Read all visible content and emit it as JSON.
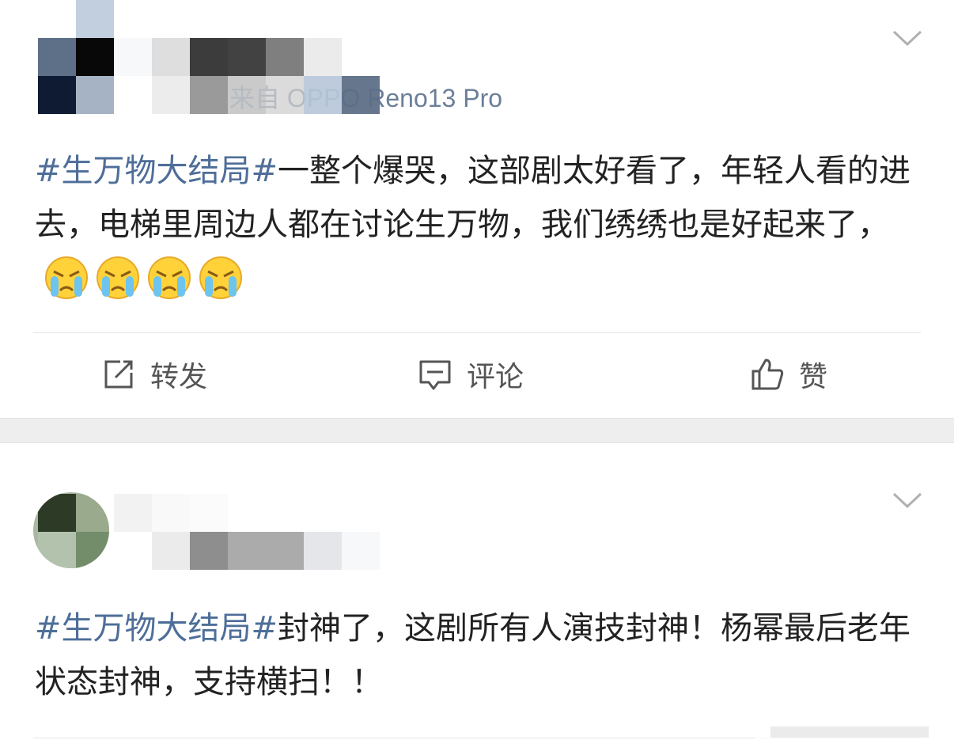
{
  "posts": [
    {
      "source": "来自 OPPO Reno13 Pro",
      "hashtag": "#生万物大结局#",
      "text": "一整个爆哭，这部剧太好看了，年轻人看的进去，电梯里周边人都在讨论生万物，我们绣绣也是好起来了，",
      "emojis": [
        "crying-face",
        "crying-face",
        "crying-face",
        "crying-face"
      ],
      "actions": {
        "repost": "转发",
        "comment": "评论",
        "like": "赞"
      }
    },
    {
      "hashtag": "#生万物大结局#",
      "text": "封神了，这剧所有人演技封神！杨幂最后老年状态封神，支持横扫！！"
    }
  ],
  "colors": {
    "hashtag": "#4e6e99",
    "body_text": "#222222",
    "meta_text": "#6b7f99",
    "separator": "#eeeeee"
  },
  "icons": [
    "chevron-down-icon",
    "repost-icon",
    "comment-icon",
    "like-icon",
    "crying-face-emoji"
  ]
}
